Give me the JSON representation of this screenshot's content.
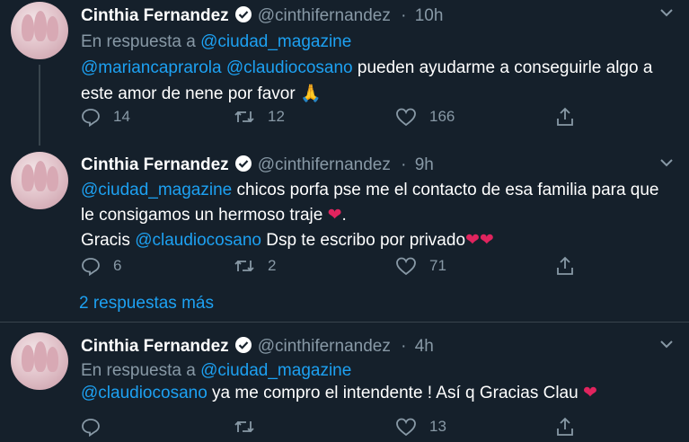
{
  "tweets": [
    {
      "name": "Cinthia Fernandez",
      "handle": "@cinthifernandez",
      "sep": "·",
      "time": "10h",
      "reply_prefix": "En respuesta a",
      "reply_mention": "@ciudad_magazine",
      "body_mention_1": "@mariancaprarola",
      "body_mention_2": "@claudiocosano",
      "body_text": " pueden ayudarme a conseguirle algo a este amor de nene por favor ",
      "emoji": "🙏",
      "replies": "14",
      "retweets": "12",
      "likes": "166"
    },
    {
      "name": "Cinthia Fernandez",
      "handle": "@cinthifernandez",
      "sep": "·",
      "time": "9h",
      "body_mention_1": "@ciudad_magazine",
      "body_text_1": " chicos porfa pse me el contacto de esa familia para que le consigamos un hermoso traje ",
      "body_text_1_end": ".",
      "body_text_2_start": "Gracis ",
      "body_mention_2": "@claudiocosano",
      "body_text_2": " Dsp te escribo por privado",
      "replies": "6",
      "retweets": "2",
      "likes": "71"
    },
    {
      "name": "Cinthia Fernandez",
      "handle": "@cinthifernandez",
      "sep": "·",
      "time": "4h",
      "reply_prefix": "En respuesta a",
      "reply_mention": "@ciudad_magazine",
      "body_mention_1": "@claudiocosano",
      "body_text": " ya me compro el intendente ! Así q Gracias Clau ",
      "replies": "",
      "retweets": "",
      "likes": "13"
    }
  ],
  "more_replies": "2 respuestas más",
  "colors": {
    "background": "#15202b",
    "link": "#1da1f2",
    "muted": "#8899a6",
    "heart": "#e0245e",
    "divider": "#38444d"
  }
}
